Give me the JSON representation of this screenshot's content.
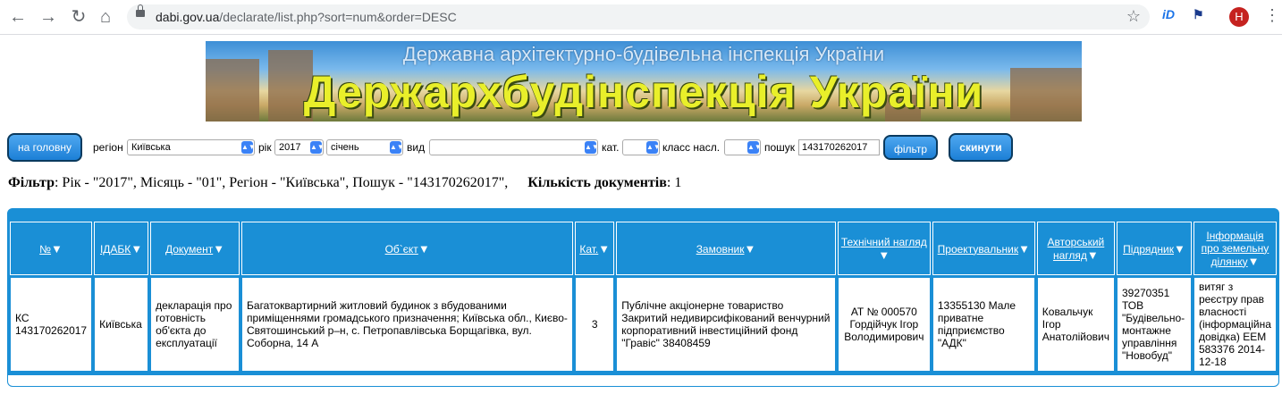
{
  "browser": {
    "url_domain": "dabi.gov.ua",
    "url_path": "/declarate/list.php?sort=num&order=DESC",
    "avatar_letter": "H",
    "ext1_label": "iD"
  },
  "banner": {
    "subtitle": "Державна архітектурно-будівельна інспекція України",
    "title": "Держархбудінспекція України"
  },
  "filters": {
    "home_button": "на головну",
    "region_label": "регіон",
    "region_value": "Київська",
    "year_label": "рік",
    "year_value": "2017",
    "month_value": "січень",
    "type_label": "вид",
    "type_value": "",
    "category_label": "кат.",
    "category_value": "",
    "class_label": "класс насл.",
    "class_value": "",
    "search_label": "пошук",
    "search_value": "143170262017",
    "filter_button": "фільтр",
    "reset_button": "скинути"
  },
  "summary": {
    "filter_label": "Фільтр",
    "filter_text": ": Рік - \"2017\", Місяць - \"01\", Регіон - \"Київська\", Пошук - \"143170262017\",",
    "count_label": "Кількість документів",
    "count_value": ": 1"
  },
  "table": {
    "headers": [
      "№",
      "ІДАБК",
      "Документ",
      "Об`єкт",
      "Кат.",
      "Замовник",
      "Технічний нагляд",
      "Проектувальник",
      "Авторський нагляд",
      "Підрядник",
      "Інформація про земельну ділянку"
    ],
    "rows": [
      {
        "num": "КС 143170262017",
        "idabk": "Київська",
        "document": "декларація про готовність об'єкта до експлуатації",
        "object": "Багатоквартирний житловий будинок з вбудованими приміщеннями громадського призначення; Київська обл., Києво-Святошинський р–н, с. Петропавлівська Борщагівка, вул. Соборна, 14 А",
        "category": "3",
        "customer": "Публічне акціонерне товариство Закритий недивирсифікований венчурний корпоративний інвестиційний фонд \"Гравіс\" 38408459",
        "tech_supervision": "АТ № 000570 Гордійчук Ігор Володимирович",
        "designer": "13355130 Мале приватне підприємство \"АДК\"",
        "author_supervision": "Ковальчук Ігор Анатолійович",
        "contractor": "39270351 ТОВ \"Будівельно-монтажне управління \"Новобуд\"",
        "land_info": "витяг з реєстру прав власності (інформаційна довідка) ЕЕМ 583376 2014-12-18"
      }
    ]
  }
}
